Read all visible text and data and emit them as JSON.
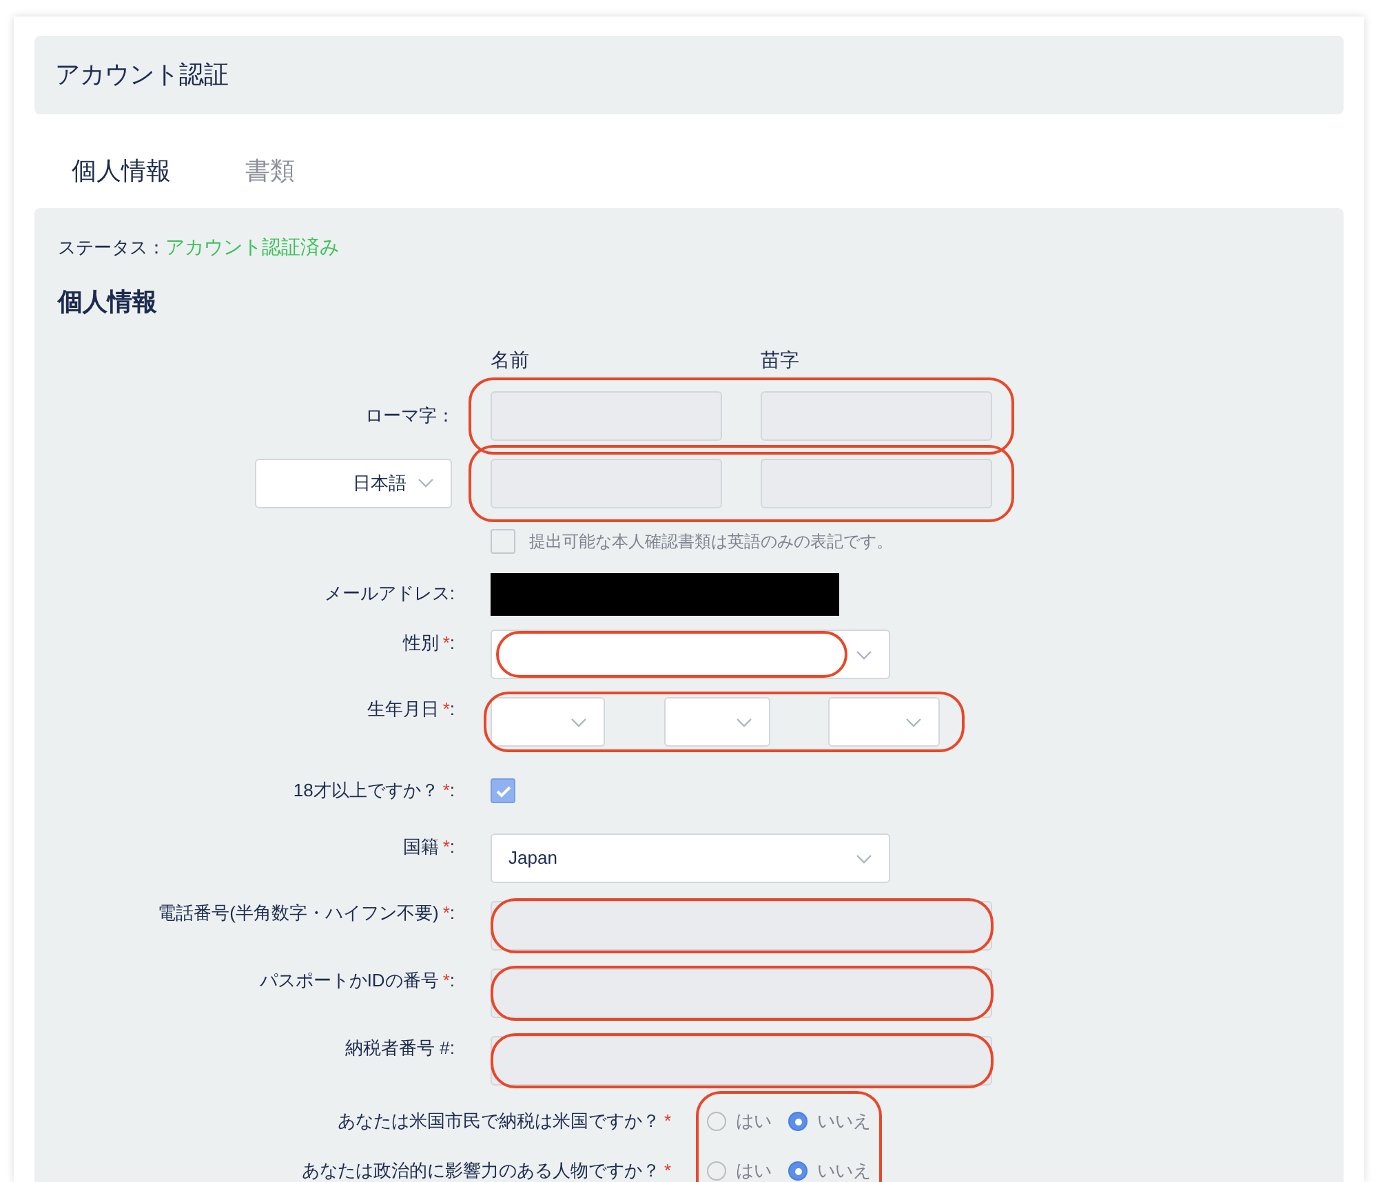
{
  "header": {
    "title": "アカウント認証"
  },
  "tabs": [
    {
      "label": "個人情報",
      "selected": true
    },
    {
      "label": "書類",
      "selected": false
    }
  ],
  "status": {
    "label": "ステータス：",
    "value": "アカウント認証済み"
  },
  "section_title": "個人情報",
  "name_columns": [
    "名前",
    "苗字"
  ],
  "rows": [
    {
      "kind": "name_pair",
      "label": "ローマ字：",
      "highlighted": true
    },
    {
      "kind": "name_pair",
      "select": {
        "value": "日本語"
      },
      "highlighted": true
    },
    {
      "kind": "checkbox",
      "text": "提出可能な本人確認書類は英語のみの表記です。",
      "checked": false
    },
    {
      "kind": "redacted",
      "label": "メールアドレス:"
    },
    {
      "kind": "select",
      "label": "性別",
      "marker": "*",
      "colon": ":",
      "highlighted": true
    },
    {
      "kind": "date",
      "label": "生年月日",
      "marker": "*",
      "colon": ":",
      "highlighted": true
    },
    {
      "kind": "checkbox",
      "label": "18才以上ですか？",
      "marker": "*",
      "colon": ":",
      "checked": true
    },
    {
      "kind": "select",
      "label": "国籍",
      "marker": "*",
      "colon": ":",
      "value": "Japan",
      "highlighted": false
    },
    {
      "kind": "text",
      "label": "電話番号(半角数字・ハイフン不要)",
      "marker": "*",
      "colon": ":",
      "highlighted": true
    },
    {
      "kind": "text",
      "label": "パスポートかIDの番号",
      "marker": "*",
      "colon": ":",
      "highlighted": true
    },
    {
      "kind": "text",
      "label": "納税者番号 #:",
      "highlighted": true
    }
  ],
  "questions": {
    "highlighted": true,
    "items": [
      {
        "label": "あなたは米国市民で納税は米国ですか？",
        "marker": "*",
        "options": [
          {
            "label": "はい",
            "selected": false
          },
          {
            "label": "いいえ",
            "selected": true
          }
        ]
      },
      {
        "label": "あなたは政治的に影響力のある人物ですか？",
        "marker": "*",
        "options": [
          {
            "label": "はい",
            "selected": false
          },
          {
            "label": "いいえ",
            "selected": true
          }
        ]
      }
    ]
  }
}
